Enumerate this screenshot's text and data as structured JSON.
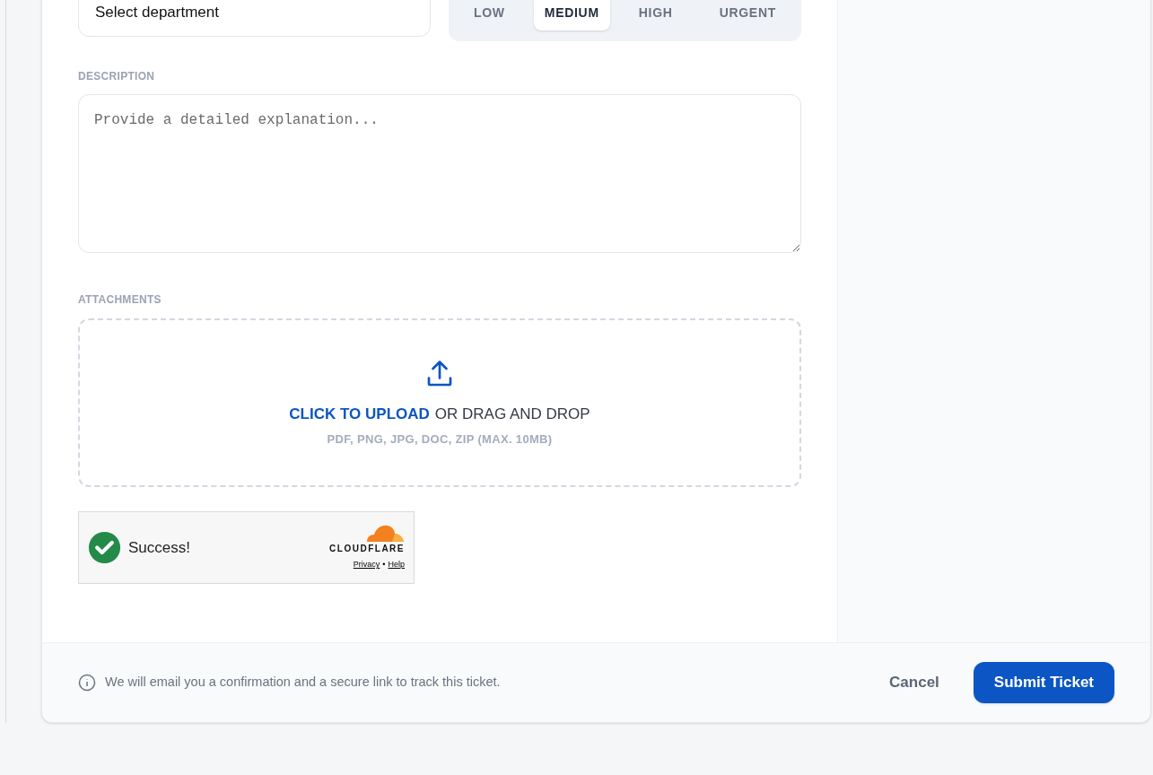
{
  "department": {
    "value": "Select department"
  },
  "priority": [
    {
      "label": "LOW",
      "selected": false
    },
    {
      "label": "MEDIUM",
      "selected": true
    },
    {
      "label": "HIGH",
      "selected": false
    },
    {
      "label": "URGENT",
      "selected": false
    }
  ],
  "description": {
    "label": "DESCRIPTION",
    "placeholder": "Provide a detailed explanation..."
  },
  "attachments": {
    "label": "ATTACHMENTS",
    "link": "CLICK TO UPLOAD",
    "rest": "OR DRAG AND DROP",
    "hint": "PDF, PNG, JPG, DOC, ZIP (MAX. 10MB)"
  },
  "captcha": {
    "status": "Success!",
    "brand": "CLOUDFLARE",
    "links": [
      "Privacy",
      "Help"
    ],
    "separator": "•"
  },
  "footer": {
    "note": "We will email you a confirmation and a secure link to track this ticket.",
    "cancel": "Cancel",
    "submit": "Submit Ticket"
  }
}
